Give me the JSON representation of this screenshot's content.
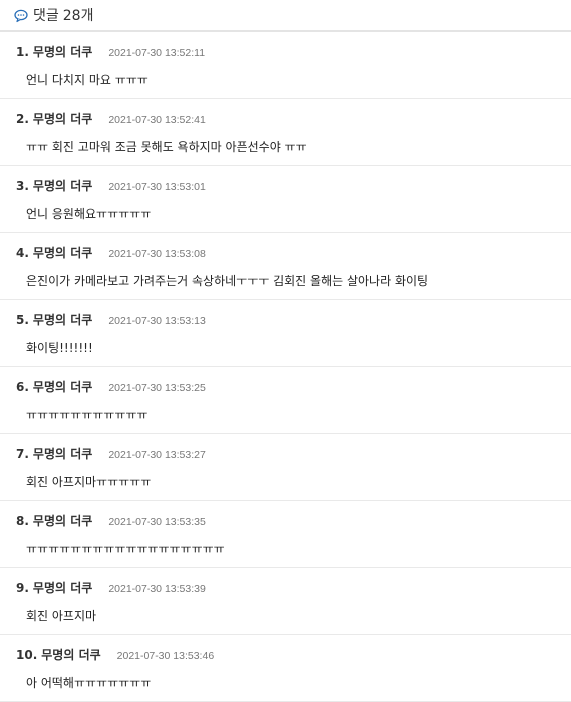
{
  "header": {
    "title": "댓글",
    "count": "28개",
    "icon": "speech-bubble-icon",
    "accent": "#2a6fb8"
  },
  "comments": [
    {
      "num": "1.",
      "author": "무명의 더쿠",
      "time": "2021-07-30 13:52:11",
      "text": "언니 다치지 마요 ㅠㅠㅠ"
    },
    {
      "num": "2.",
      "author": "무명의 더쿠",
      "time": "2021-07-30 13:52:41",
      "text": "ㅠㅠ 회진 고마워 조금 못해도 욕하지마 아픈선수야 ㅠㅠ"
    },
    {
      "num": "3.",
      "author": "무명의 더쿠",
      "time": "2021-07-30 13:53:01",
      "text": "언니 응원해요ㅠㅠㅠㅠㅠ"
    },
    {
      "num": "4.",
      "author": "무명의 더쿠",
      "time": "2021-07-30 13:53:08",
      "text": "은진이가 카메라보고 가려주는거 속상하네ㅜㅜㅜ 김회진 올해는 살아나라 화이팅"
    },
    {
      "num": "5.",
      "author": "무명의 더쿠",
      "time": "2021-07-30 13:53:13",
      "text": "화이팅!!!!!!!"
    },
    {
      "num": "6.",
      "author": "무명의 더쿠",
      "time": "2021-07-30 13:53:25",
      "text": "ㅠㅠㅠㅠㅠㅠㅠㅠㅠㅠㅠ"
    },
    {
      "num": "7.",
      "author": "무명의 더쿠",
      "time": "2021-07-30 13:53:27",
      "text": "회진 아프지마ㅠㅠㅠㅠㅠ"
    },
    {
      "num": "8.",
      "author": "무명의 더쿠",
      "time": "2021-07-30 13:53:35",
      "text": "ㅠㅠㅠㅠㅠㅠㅠㅠㅠㅠㅠㅠㅠㅠㅠㅠㅠㅠ"
    },
    {
      "num": "9.",
      "author": "무명의 더쿠",
      "time": "2021-07-30 13:53:39",
      "text": "회진 아프지마"
    },
    {
      "num": "10.",
      "author": "무명의 더쿠",
      "time": "2021-07-30 13:53:46",
      "text": "아 어떡해ㅠㅠㅠㅠㅠㅠㅠ"
    }
  ]
}
